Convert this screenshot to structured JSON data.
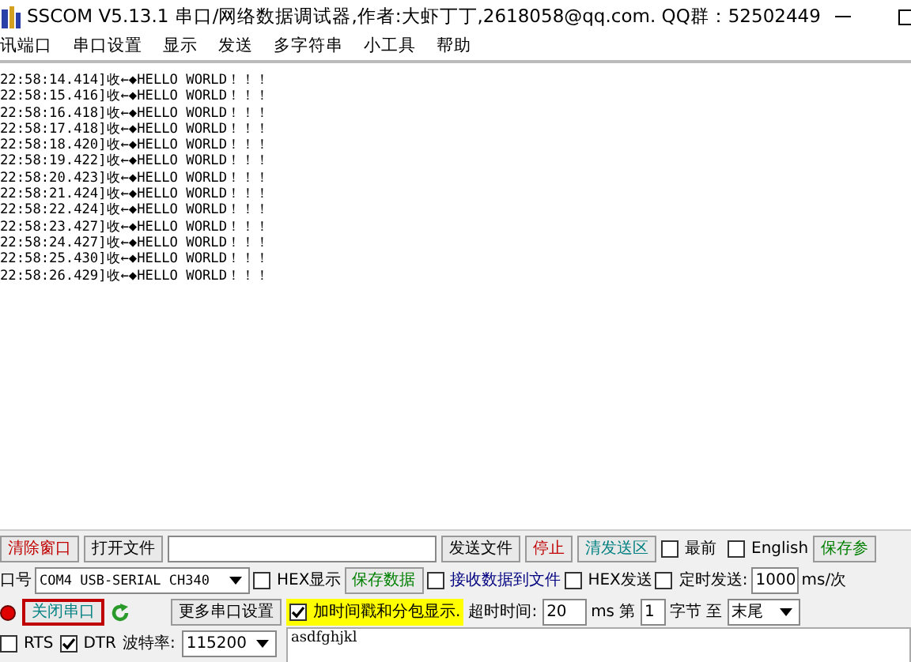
{
  "window": {
    "title": "SSCOM V5.13.1 串口/网络数据调试器,作者:大虾丁丁,2618058@qq.com. QQ群：52502449"
  },
  "menu": [
    "讯端口",
    "串口设置",
    "显示",
    "发送",
    "多字符串",
    "小工具",
    "帮助"
  ],
  "log_lines": [
    "22:58:14.414]收←◆HELLO WORLD！！！",
    "22:58:15.416]收←◆HELLO WORLD！！！",
    "22:58:16.418]收←◆HELLO WORLD！！！",
    "22:58:17.418]收←◆HELLO WORLD！！！",
    "22:58:18.420]收←◆HELLO WORLD！！！",
    "22:58:19.422]收←◆HELLO WORLD！！！",
    "22:58:20.423]收←◆HELLO WORLD！！！",
    "22:58:21.424]收←◆HELLO WORLD！！！",
    "22:58:22.424]收←◆HELLO WORLD！！！",
    "22:58:23.427]收←◆HELLO WORLD！！！",
    "22:58:24.427]收←◆HELLO WORLD！！！",
    "22:58:25.430]收←◆HELLO WORLD！！！",
    "22:58:26.429]收←◆HELLO WORLD！！！"
  ],
  "toolbar": {
    "clear_button": "清除窗口",
    "open_file_button": "打开文件",
    "send_file_button": "发送文件",
    "stop_button": "停止",
    "clear_send_button": "清发送区",
    "topmost": {
      "label": "最前",
      "checked": false
    },
    "english": {
      "label": "English",
      "checked": false
    },
    "save_params_button": "保存参"
  },
  "port": {
    "label": "口号",
    "value": "COM4 USB-SERIAL CH340",
    "hex_display": {
      "label": "HEX显示",
      "checked": false
    },
    "save_data_button": "保存数据",
    "recv_to_file": {
      "label": "接收数据到文件",
      "checked": false
    },
    "hex_send": {
      "label": "HEX发送",
      "checked": false
    },
    "timed_send": {
      "label": "定时发送:",
      "checked": false
    },
    "interval": "1000",
    "interval_unit": "ms/次"
  },
  "row3": {
    "close_port_button": "关闭串口",
    "port_open": true,
    "more_settings_button": "更多串口设置",
    "timestamp": {
      "label": "加时间戳和分包显示.",
      "checked": true
    },
    "timeout_label": "超时时间:",
    "timeout": "20",
    "timeout_unit": "ms",
    "byte_prefix": "第",
    "byte_from": "1",
    "byte_label": "字节",
    "to_label": "至",
    "byte_to": "末尾"
  },
  "row4": {
    "rts": {
      "label": "RTS",
      "checked": false
    },
    "dtr": {
      "label": "DTR",
      "checked": true
    },
    "baud_label": "波特率:",
    "baud": "115200",
    "send_text": "asdfghjkl"
  }
}
